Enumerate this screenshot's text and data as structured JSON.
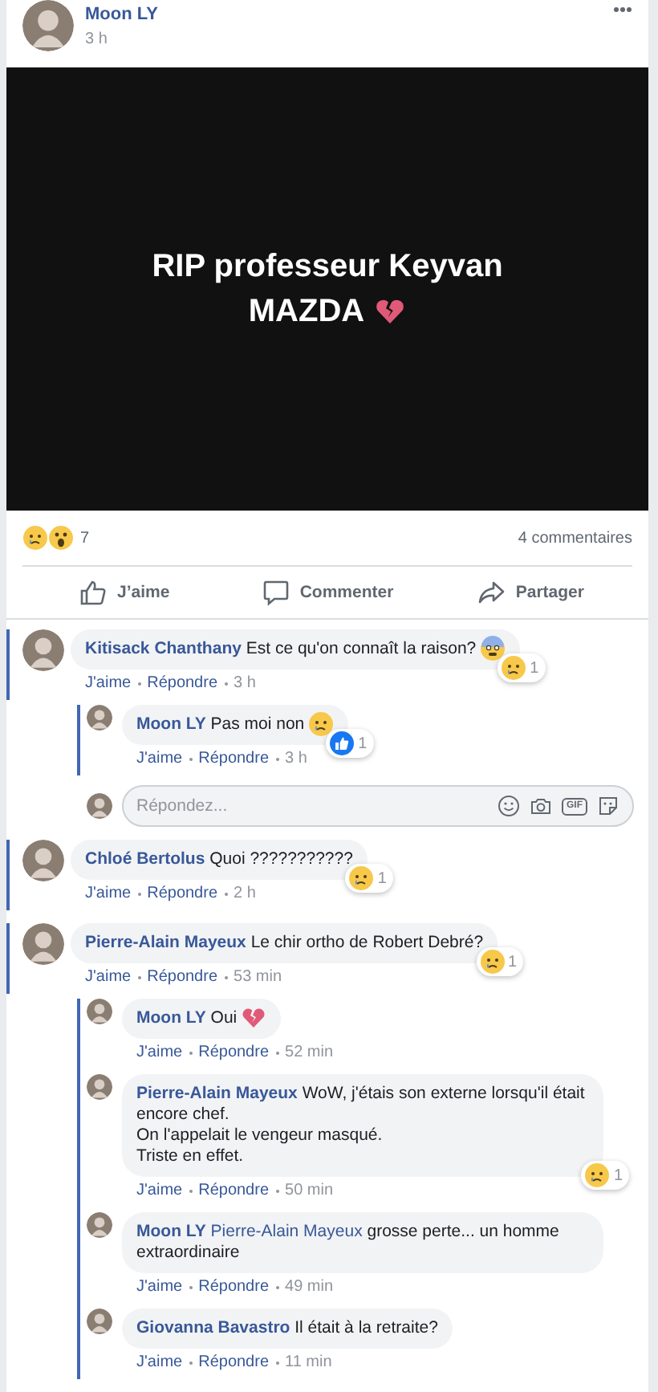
{
  "post": {
    "author": "Moon LY",
    "time": "3 h",
    "caption_lines": [
      "RIP professeur Keyvan",
      "MAZDA"
    ],
    "kind": "heartbreak"
  },
  "reactions": {
    "count": "7",
    "comments": "4 commentaires"
  },
  "actions": [
    {
      "label": "J’aime"
    },
    {
      "label": "Commenter"
    },
    {
      "label": "Partager"
    }
  ],
  "comments": [
    {
      "kind": "fear",
      "author": "Kitisack Chanthany",
      "text": "Est ce qu'on connaît la raison?",
      "reaction": {
        "kind": "sad",
        "count": "1"
      },
      "like": "J'aime",
      "reply": "Répondre",
      "time": "3 h",
      "replies": [
        {
          "kind": "sad",
          "author": "Moon LY",
          "text": "Pas moi non",
          "reaction": {
            "kind": "like",
            "count": "1"
          },
          "like": "J'aime",
          "reply": "Répondre",
          "time": "3 h"
        }
      ],
      "reply_field": {
        "placeholder": "Répondez...",
        "gif_label": "GIF"
      }
    },
    {
      "kind": "plain",
      "author": "Chloé Bertolus",
      "text": "Quoi ???????????",
      "reaction": {
        "kind": "sad",
        "count": "1"
      },
      "like": "J'aime",
      "reply": "Répondre",
      "time": "2 h"
    },
    {
      "kind": "plain",
      "author": "Pierre-Alain Mayeux",
      "text": "Le chir ortho de Robert Debré?",
      "reaction": {
        "kind": "sad",
        "count": "1"
      },
      "like": "J'aime",
      "reply": "Répondre",
      "time": "53 min",
      "replies": [
        {
          "kind": "heartbreak",
          "author": "Moon LY",
          "text": "Oui",
          "like": "J'aime",
          "reply": "Répondre",
          "time": "52 min"
        },
        {
          "kind": "plain",
          "author": "Pierre-Alain Mayeux",
          "text": "WoW, j'étais son externe lorsqu'il était encore chef.\nOn l'appelait le vengeur masqué.\nTriste en effet.",
          "reaction": {
            "kind": "sad",
            "count": "1"
          },
          "like": "J'aime",
          "reply": "Répondre",
          "time": "50 min"
        },
        {
          "kind": "plain",
          "author": "Moon LY",
          "mention": "Pierre-Alain Mayeux",
          "text": "grosse perte... un homme extraordinaire",
          "like": "J'aime",
          "reply": "Répondre",
          "time": "49 min"
        },
        {
          "kind": "plain",
          "author": "Giovanna Bavastro",
          "text": "Il était à la retraite?",
          "like": "J'aime",
          "reply": "Répondre",
          "time": "11 min"
        }
      ]
    }
  ]
}
